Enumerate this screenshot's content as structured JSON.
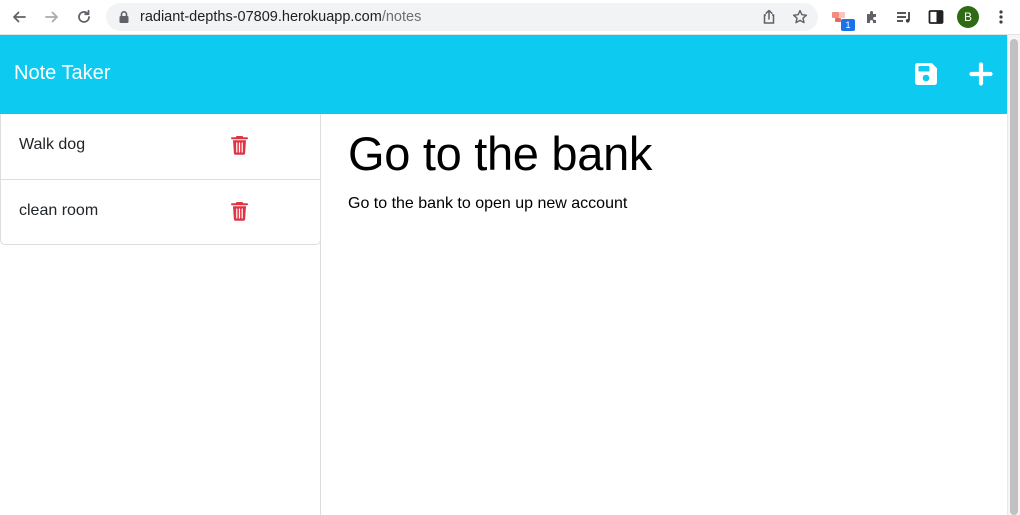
{
  "browser": {
    "url_host": "radiant-depths-07809.herokuapp.com",
    "url_path": "/notes",
    "extension_badge": "1",
    "profile_initial": "B",
    "icons": [
      "back-arrow-icon",
      "forward-arrow-icon",
      "reload-icon",
      "lock-icon",
      "share-icon",
      "star-icon",
      "extension-icon",
      "puzzle-icon",
      "media-queue-icon",
      "side-panel-icon",
      "kebab-menu-icon"
    ]
  },
  "header": {
    "brand": "Note Taker",
    "background": "#0dcaf0",
    "icons": [
      "save-icon",
      "plus-icon"
    ]
  },
  "notes": [
    {
      "title": "Walk dog"
    },
    {
      "title": "clean room"
    }
  ],
  "trash_color": "#dc3545",
  "active_note": {
    "title": "Go to the bank",
    "text": "Go to the bank to open up new account"
  }
}
